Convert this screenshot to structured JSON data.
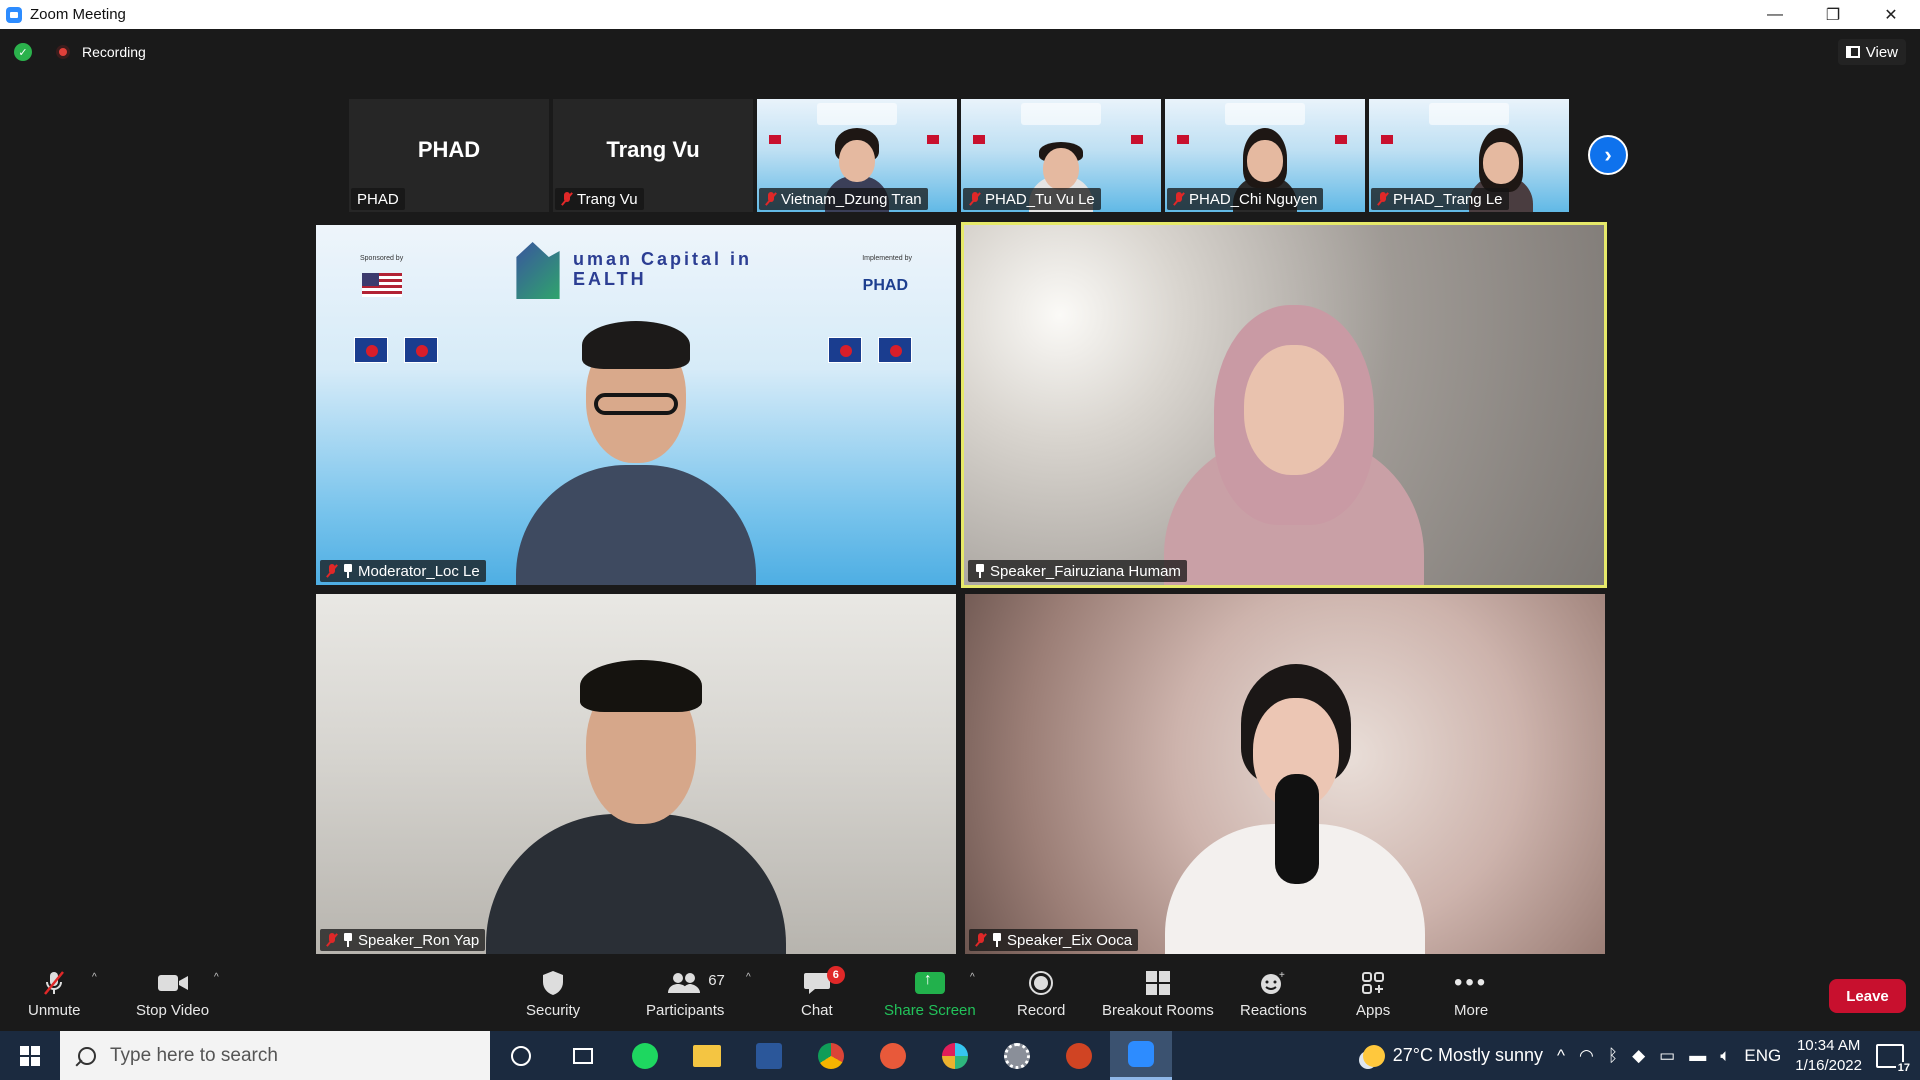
{
  "window": {
    "title": "Zoom Meeting",
    "minimize": "—",
    "restore": "❐",
    "close": "✕"
  },
  "topbar": {
    "recording_label": "Recording",
    "view_label": "View"
  },
  "filmstrip": [
    {
      "big_name": "PHAD",
      "label": "PHAD",
      "muted": false
    },
    {
      "big_name": "Trang Vu",
      "label": "Trang Vu",
      "muted": true
    },
    {
      "label": "Vietnam_Dzung Tran",
      "muted": true
    },
    {
      "label": "PHAD_Tu Vu Le",
      "muted": true
    },
    {
      "label": "PHAD_Chi Nguyen",
      "muted": true
    },
    {
      "label": "PHAD_Trang Le",
      "muted": true
    }
  ],
  "next_page": "›",
  "tiles": {
    "t1": {
      "label": "Moderator_Loc Le",
      "logo_text": "uman Capital in EALTH",
      "sponsored_by": "Sponsored by",
      "implemented_by": "Implemented by",
      "phad": "PHAD"
    },
    "t2": {
      "label": "Speaker_Fairuziana Humam"
    },
    "t3": {
      "label": "Speaker_Ron Yap"
    },
    "t4": {
      "label": "Speaker_Eix Ooca"
    }
  },
  "toolbar": {
    "unmute": "Unmute",
    "stop_video": "Stop Video",
    "security": "Security",
    "participants": "Participants",
    "participants_count": "67",
    "chat": "Chat",
    "chat_badge": "6",
    "share_screen": "Share Screen",
    "record": "Record",
    "breakout_rooms": "Breakout Rooms",
    "reactions": "Reactions",
    "apps": "Apps",
    "more": "More",
    "leave": "Leave"
  },
  "taskbar": {
    "search_placeholder": "Type here to search",
    "weather": "27°C  Mostly sunny",
    "lang": "ENG",
    "time": "10:34 AM",
    "date": "1/16/2022",
    "notifications": "17"
  },
  "colors": {
    "accent_blue": "#0e72ed",
    "active_speaker": "#e6e96a",
    "leave_red": "#c8102e",
    "share_green": "#22b14c"
  }
}
